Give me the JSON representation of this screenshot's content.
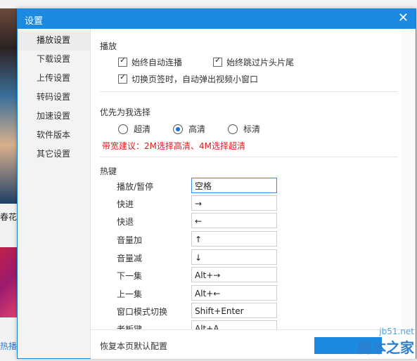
{
  "background": {
    "caption": "春花",
    "hot_text": "热播"
  },
  "dialog": {
    "title": "设置",
    "close_glyph": "✕"
  },
  "sidebar": {
    "items": [
      {
        "label": "播放设置"
      },
      {
        "label": "下载设置"
      },
      {
        "label": "上传设置"
      },
      {
        "label": "转码设置"
      },
      {
        "label": "加速设置"
      },
      {
        "label": "软件版本"
      },
      {
        "label": "其它设置"
      }
    ]
  },
  "play": {
    "title": "播放",
    "auto_continue": "始终自动连播",
    "skip_intro": "始终跳过片头片尾",
    "popup_mini": "切换页签时，自动弹出视频小窗口"
  },
  "quality": {
    "title": "优先为我选择",
    "options": [
      "超清",
      "高清",
      "标清"
    ],
    "selected": "高清",
    "hint": "带宽建议：2M选择高清、4M选择超清"
  },
  "hotkeys": {
    "title": "热键",
    "rows": [
      {
        "label": "播放/暂停",
        "value": "空格"
      },
      {
        "label": "快进",
        "value": "→"
      },
      {
        "label": "快退",
        "value": "←"
      },
      {
        "label": "音量加",
        "value": "↑"
      },
      {
        "label": "音量减",
        "value": "↓"
      },
      {
        "label": "下一集",
        "value": "Alt+→"
      },
      {
        "label": "上一集",
        "value": "Alt+←"
      },
      {
        "label": "窗口模式切换",
        "value": "Shift+Enter"
      },
      {
        "label": "老板键",
        "value": "Alt+A"
      }
    ]
  },
  "footer": {
    "restore": "恢复本页默认配置"
  },
  "watermark": {
    "line1": "jb51.net",
    "line2": "脚本之家"
  },
  "colors": {
    "accent": "#1c8ae0",
    "hint": "#e02020"
  }
}
